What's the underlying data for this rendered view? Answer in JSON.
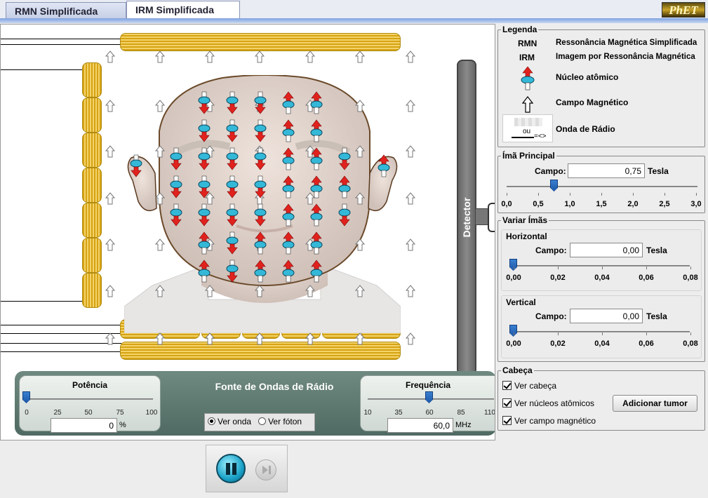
{
  "tabs": [
    {
      "label": "RMN Simplificada",
      "active": false
    },
    {
      "label": "IRM Simplificada",
      "active": true
    }
  ],
  "logo": "PhET",
  "detector_label": "Detector",
  "radio_source": {
    "title": "Fonte de Ondas de Rádio",
    "power": {
      "title": "Potência",
      "ticks": [
        "0",
        "25",
        "50",
        "75",
        "100"
      ],
      "value": "0",
      "unit": "%"
    },
    "frequency": {
      "title": "Frequência",
      "ticks": [
        "10",
        "35",
        "60",
        "85",
        "110"
      ],
      "value": "60,0",
      "unit": "MHz"
    },
    "view_options": [
      {
        "label": "Ver onda",
        "selected": true
      },
      {
        "label": "Ver fóton",
        "selected": false
      }
    ]
  },
  "legend": {
    "title": "Legenda",
    "rmn_abbr": "RMN",
    "rmn_text": "Ressonância Magnética Simplificada",
    "irm_abbr": "IRM",
    "irm_text": "Imagem por Ressonância Magnética",
    "nucleus": "Núcleo atômico",
    "field": "Campo Magnético",
    "wave_or": "ou",
    "wave": "Onda de Rádio"
  },
  "main_magnet": {
    "title": "Ímã Principal",
    "field_label": "Campo:",
    "value": "0,75",
    "unit": "Tesla",
    "ticks": [
      "0,0",
      "0,5",
      "1,0",
      "1,5",
      "2,0",
      "2,5",
      "3,0"
    ]
  },
  "vary_magnets": {
    "title": "Variar Ímãs",
    "horizontal": {
      "title": "Horizontal",
      "field_label": "Campo:",
      "value": "0,00",
      "unit": "Tesla",
      "ticks": [
        "0,00",
        "0,02",
        "0,04",
        "0,06",
        "0,08"
      ]
    },
    "vertical": {
      "title": "Vertical",
      "field_label": "Campo:",
      "value": "0,00",
      "unit": "Tesla",
      "ticks": [
        "0,00",
        "0,02",
        "0,04",
        "0,06",
        "0,08"
      ]
    }
  },
  "head_panel": {
    "title": "Cabeça",
    "show_head": "Ver cabeça",
    "show_nuclei": "Ver núcleos atômicos",
    "show_field": "Ver campo magnético",
    "add_tumor": "Adicionar tumor"
  },
  "colors": {
    "coil": "#e2b228",
    "nucleus_up": "#e0221e",
    "nucleus_body": "#34b8d8",
    "tab_bar": "#7fa2e0"
  }
}
